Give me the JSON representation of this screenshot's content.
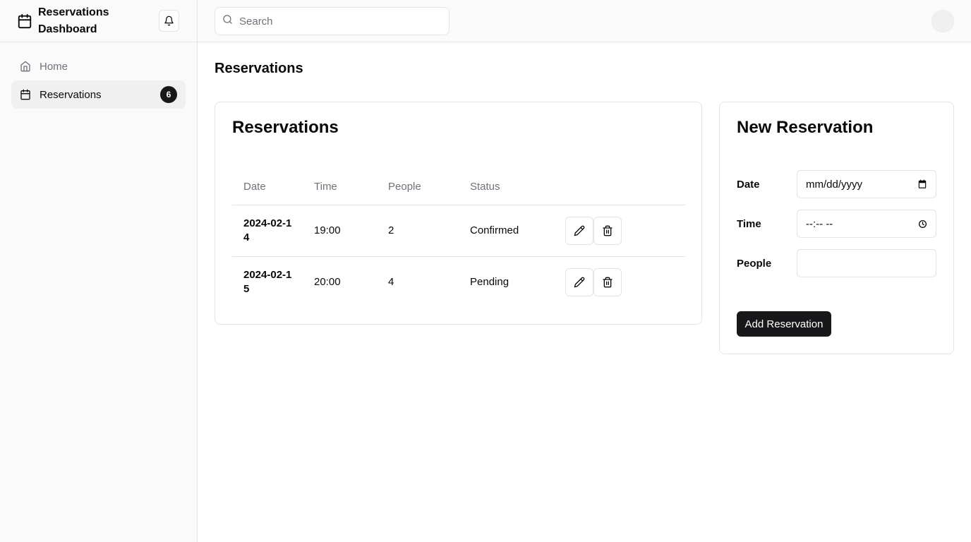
{
  "app": {
    "title": "Reservations Dashboard",
    "title_line1": "Reservations",
    "title_line2": "Dashboard"
  },
  "sidebar": {
    "items": [
      {
        "label": "Home",
        "icon": "home-icon"
      },
      {
        "label": "Reservations",
        "icon": "calendar-icon",
        "badge": "6",
        "active": true
      }
    ]
  },
  "header": {
    "search_placeholder": "Search"
  },
  "main": {
    "page_title": "Reservations",
    "list_card": {
      "title": "Reservations",
      "columns": [
        "Date",
        "Time",
        "People",
        "Status"
      ],
      "rows": [
        {
          "date": "2024-02-14",
          "time": "19:00",
          "people": "2",
          "status": "Confirmed"
        },
        {
          "date": "2024-02-15",
          "time": "20:00",
          "people": "4",
          "status": "Pending"
        }
      ]
    },
    "form_card": {
      "title": "New Reservation",
      "date_label": "Date",
      "date_placeholder": "mm/dd/yyyy",
      "time_label": "Time",
      "time_placeholder": "--:-- --",
      "people_label": "People",
      "people_value": "",
      "submit_label": "Add Reservation"
    }
  },
  "colors": {
    "accent": "#18181b",
    "border": "#e4e4e7",
    "muted_text": "#71717a",
    "sidebar_bg": "#fafafa"
  }
}
